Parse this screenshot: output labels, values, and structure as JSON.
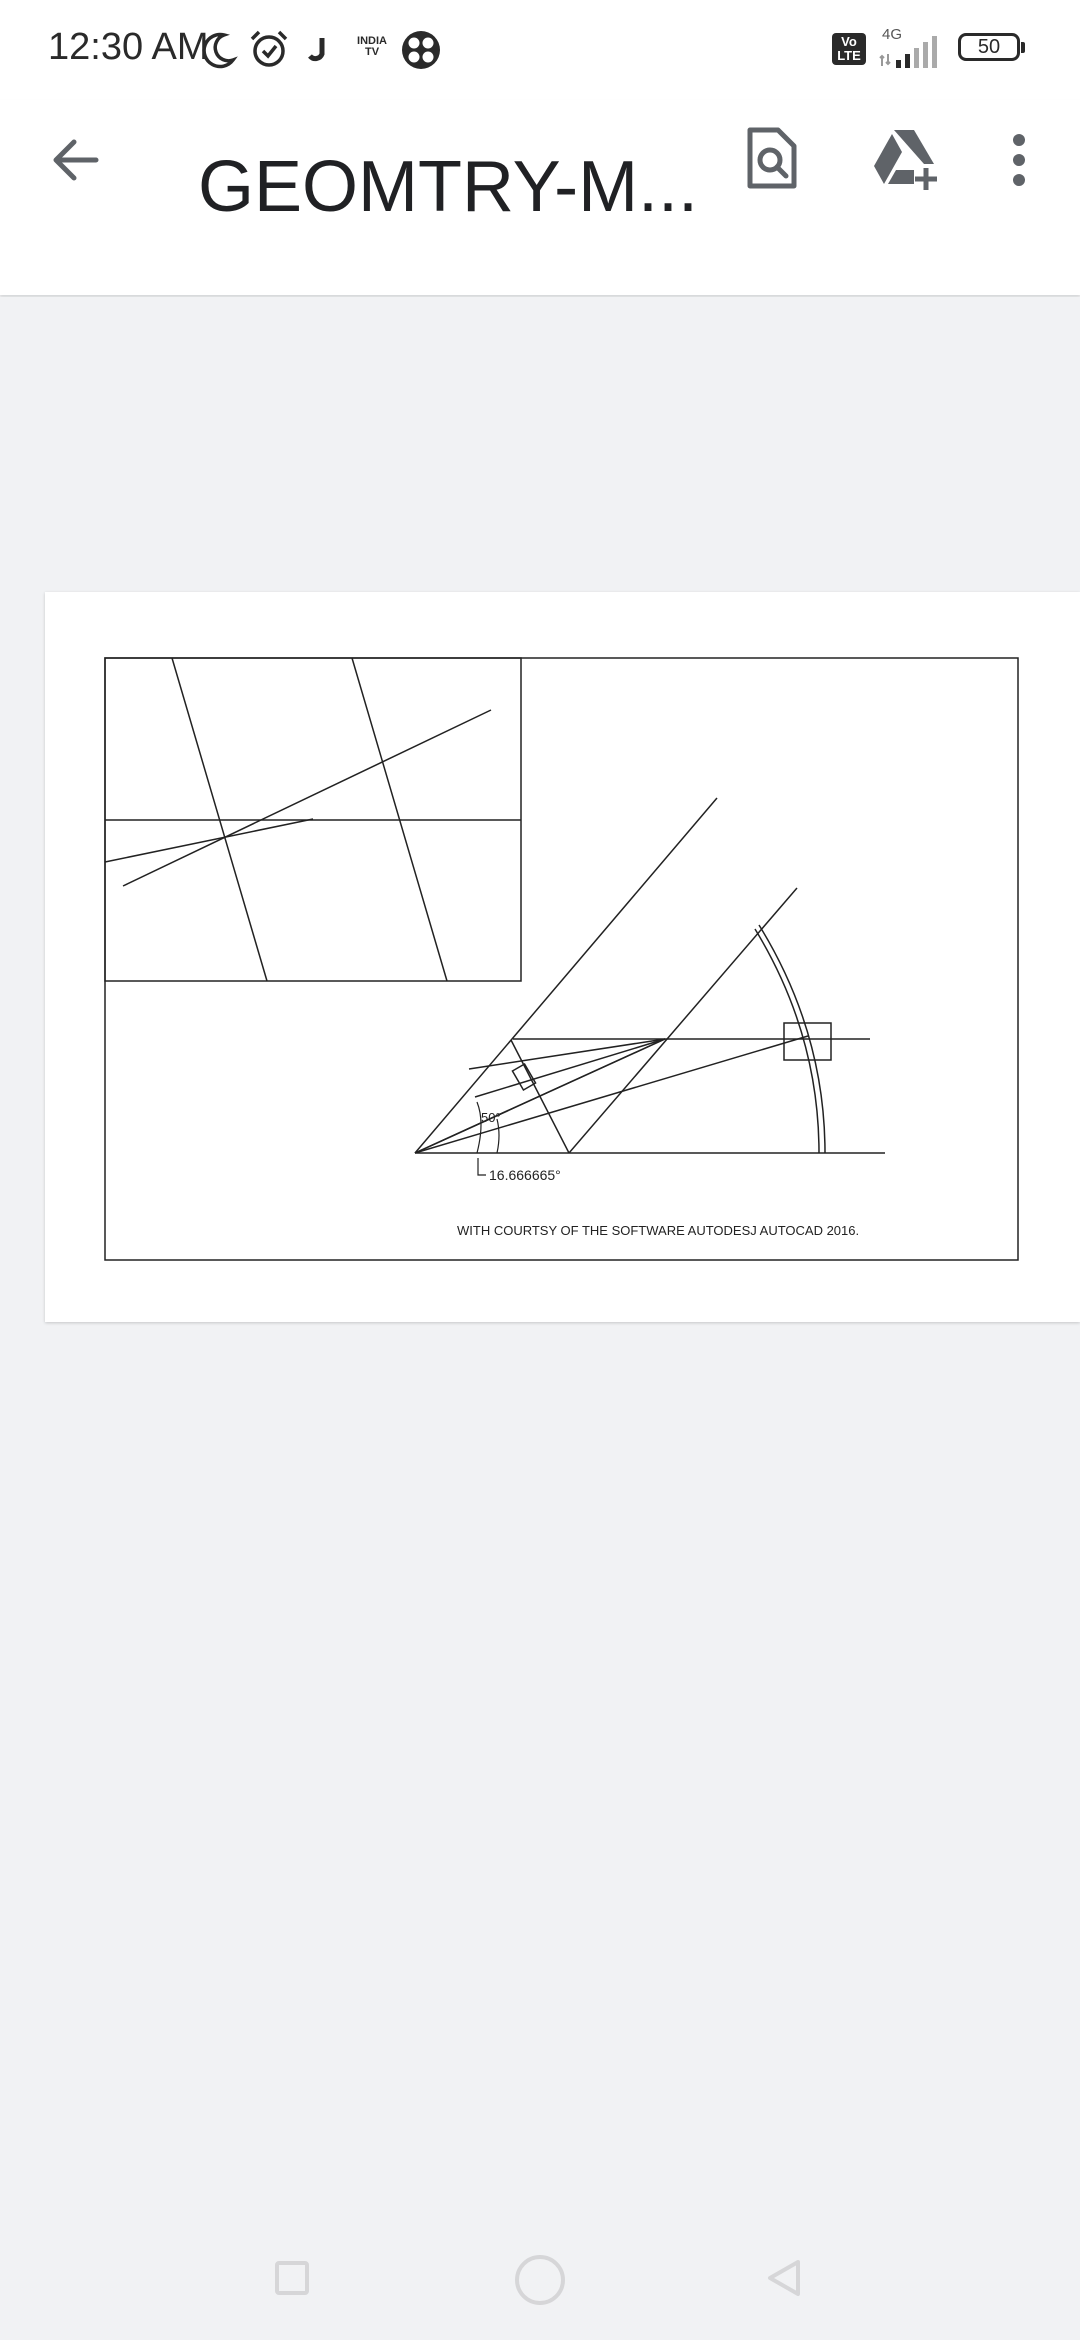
{
  "status_bar": {
    "time": "12:30 AM",
    "network_type": "4G",
    "volte_label_top": "Vo",
    "volte_label_bottom": "LTE",
    "battery": "50",
    "app_icon_india_tv_top": "INDIA",
    "app_icon_india_tv_bottom": "TV",
    "icons": [
      "moon-icon",
      "alarm-icon",
      "jio-icon",
      "india-tv-icon",
      "fan-icon",
      "volte-icon",
      "signal-icon",
      "battery-icon"
    ]
  },
  "app_bar": {
    "title": "GEOMTRY-M...",
    "icons": [
      "back-arrow-icon",
      "file-search-icon",
      "drive-add-icon",
      "more-vert-icon"
    ]
  },
  "document": {
    "angle_label_1": "50°",
    "angle_label_2": "16.666665°",
    "footer_text": "WITH COURTSY OF THE SOFTWARE AUTODESJ AUTOCAD 2016."
  },
  "nav_bar": {
    "icons": [
      "recents-square-icon",
      "home-circle-icon",
      "back-triangle-icon"
    ]
  },
  "colors": {
    "statusbar_bg": "#ffffff",
    "viewer_bg": "#f1f2f4",
    "icon_gray": "#5f6368",
    "text_dark": "#202124"
  }
}
